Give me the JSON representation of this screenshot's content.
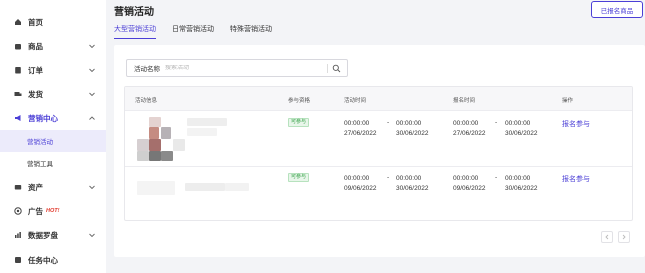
{
  "sidebar": {
    "items": [
      {
        "label": "首页",
        "icon": "home-icon"
      },
      {
        "label": "商品",
        "icon": "bag-icon"
      },
      {
        "label": "订单",
        "icon": "order-icon"
      },
      {
        "label": "发货",
        "icon": "truck-icon"
      },
      {
        "label": "营销中心",
        "icon": "megaphone-icon"
      },
      {
        "label": "资产",
        "icon": "wallet-icon"
      },
      {
        "label": "广告",
        "icon": "ad-icon",
        "badge": "HOT!"
      },
      {
        "label": "数据罗盘",
        "icon": "compass-icon"
      },
      {
        "label": "任务中心",
        "icon": "task-icon"
      }
    ],
    "sub_items": [
      {
        "label": "营销活动"
      },
      {
        "label": "营销工具"
      }
    ]
  },
  "header": {
    "title": "营销活动",
    "enrolled_button": "已报名商品"
  },
  "tabs": [
    {
      "label": "大型营销活动"
    },
    {
      "label": "日常营销活动"
    },
    {
      "label": "特殊营销活动"
    }
  ],
  "search": {
    "label": "活动名称",
    "placeholder": "搜索活动"
  },
  "table": {
    "columns": [
      "活动信息",
      "参与资格",
      "活动时间",
      "报名时间",
      "操作"
    ],
    "rows": [
      {
        "eligibility": "可参与",
        "activity_start": "00:00:00 27/06/2022",
        "activity_start_time": "00:00:00",
        "activity_start_date": "27/06/2022",
        "activity_end_time": "00:00:00",
        "activity_end_date": "30/06/2022",
        "signup_start_time": "00:00:00",
        "signup_start_date": "27/06/2022",
        "signup_end_time": "00:00:00",
        "signup_end_date": "30/06/2022",
        "action": "报名参与"
      },
      {
        "eligibility": "可参与",
        "activity_start_time": "00:00:00",
        "activity_start_date": "09/06/2022",
        "activity_end_time": "00:00:00",
        "activity_end_date": "30/06/2022",
        "signup_start_time": "00:00:00",
        "signup_start_date": "09/06/2022",
        "signup_end_time": "00:00:00",
        "signup_end_date": "30/06/2022",
        "action": "报名参与"
      }
    ],
    "dash": "-"
  },
  "colors": {
    "accent": "#4b3fd6",
    "eligible_green": "#3aa34b",
    "hot_red": "#e23b2e"
  }
}
